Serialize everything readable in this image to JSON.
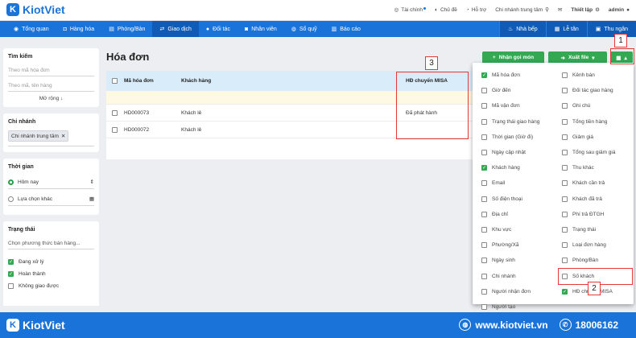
{
  "app": {
    "logo_mark": "K",
    "logo_text": "KiotViet"
  },
  "topbar": {
    "finance": "Tài chính",
    "theme": "Chủ đề",
    "support": "Hỗ trợ",
    "branch": "Chi nhánh trung tâm",
    "settings": "Thiết lập",
    "user": "admin"
  },
  "nav": {
    "items": [
      "Tổng quan",
      "Hàng hóa",
      "Phòng/Bàn",
      "Giao dịch",
      "Đối tác",
      "Nhân viên",
      "Sổ quỹ",
      "Báo cáo"
    ],
    "active_index": 3,
    "right": [
      "Nhà bếp",
      "Lễ tân",
      "Thu ngân"
    ]
  },
  "sidebar": {
    "search": {
      "title": "Tìm kiếm",
      "placeholder1": "Theo mã hóa đơn",
      "placeholder2": "Theo mã, tên hàng",
      "more": "Mở rộng ↓"
    },
    "branch": {
      "title": "Chi nhánh",
      "chip": "Chi nhánh trung tâm"
    },
    "time": {
      "title": "Thời gian",
      "opt1": "Hôm nay",
      "opt2": "Lựa chọn khác"
    },
    "status": {
      "title": "Trạng thái",
      "placeholder": "Chọn phương thức bán hàng...",
      "items": [
        {
          "label": "Đang xử lý",
          "checked": true
        },
        {
          "label": "Hoàn thành",
          "checked": true
        },
        {
          "label": "Không giao được",
          "checked": false
        }
      ]
    }
  },
  "main": {
    "title": "Hóa đơn",
    "btn_receive": "Nhận gọi món",
    "btn_export": "Xuất file"
  },
  "table": {
    "headers": [
      "Mã hóa đơn",
      "Khách hàng",
      "HĐ chuyển MISA"
    ],
    "rows": [
      {
        "code": "HD000073",
        "customer": "Khách lẻ",
        "misa": "Đã phát hành"
      },
      {
        "code": "HD000072",
        "customer": "Khách lẻ",
        "misa": ""
      }
    ]
  },
  "columns": [
    {
      "label": "Mã hóa đơn",
      "checked": true
    },
    {
      "label": "Kênh bán",
      "checked": false
    },
    {
      "label": "Giờ đến",
      "checked": false
    },
    {
      "label": "Đối tác giao hàng",
      "checked": false
    },
    {
      "label": "Mã vận đơn",
      "checked": false
    },
    {
      "label": "Ghi chú",
      "checked": false
    },
    {
      "label": "Trạng thái giao hàng",
      "checked": false
    },
    {
      "label": "Tổng tiền hàng",
      "checked": false
    },
    {
      "label": "Thời gian (Giờ đi)",
      "checked": false
    },
    {
      "label": "Giảm giá",
      "checked": false
    },
    {
      "label": "Ngày cập nhật",
      "checked": false
    },
    {
      "label": "Tổng sau giảm giá",
      "checked": false
    },
    {
      "label": "Khách hàng",
      "checked": true
    },
    {
      "label": "Thu khác",
      "checked": false
    },
    {
      "label": "Email",
      "checked": false
    },
    {
      "label": "Khách cần trả",
      "checked": false
    },
    {
      "label": "Số điện thoại",
      "checked": false
    },
    {
      "label": "Khách đã trả",
      "checked": false
    },
    {
      "label": "Địa chỉ",
      "checked": false
    },
    {
      "label": "Phí trả ĐTGH",
      "checked": false
    },
    {
      "label": "Khu vực",
      "checked": false
    },
    {
      "label": "Trạng thái",
      "checked": false
    },
    {
      "label": "Phường/Xã",
      "checked": false
    },
    {
      "label": "Loại đơn hàng",
      "checked": false
    },
    {
      "label": "Ngày sinh",
      "checked": false
    },
    {
      "label": "Phòng/Bàn",
      "checked": false
    },
    {
      "label": "Chi nhánh",
      "checked": false
    },
    {
      "label": "Số khách",
      "checked": false
    },
    {
      "label": "Người nhận đơn",
      "checked": false
    },
    {
      "label": "HĐ chuyển MISA",
      "checked": true
    },
    {
      "label": "Người tạo",
      "checked": false
    }
  ],
  "annotations": {
    "n1": "1",
    "n2": "2",
    "n3": "3"
  },
  "footer": {
    "logo_mark": "K",
    "logo_text": "KiotViet",
    "website": "www.kiotviet.vn",
    "phone": "18006162"
  },
  "colors": {
    "primary": "#1a73d9",
    "green": "#34a853",
    "annotation": "#e53935"
  }
}
